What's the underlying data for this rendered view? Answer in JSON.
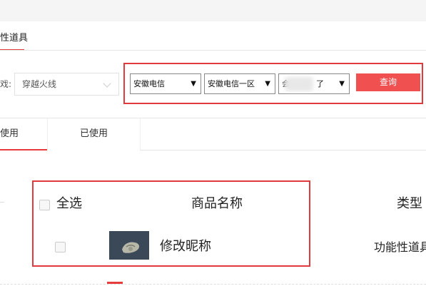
{
  "header": {
    "tab_title": "性道具"
  },
  "filters": {
    "game_label": "戏:",
    "game_value": "穿越火线",
    "telecom": "安徽电信",
    "server": "安徽电信一区",
    "role_prefix": "会",
    "role_suffix": "了",
    "query_button": "查询"
  },
  "status_tabs": {
    "unused": "使用",
    "used": "已使用"
  },
  "table": {
    "select_all": "全选",
    "col_name": "商品名称",
    "col_type": "类型"
  },
  "rows": [
    {
      "name": "修改昵称",
      "type": "功能性道具"
    }
  ],
  "colors": {
    "accent": "#e63c3c",
    "button": "#f05050",
    "highlight_box": "#e0393e"
  },
  "icons": [
    "chevron-down-icon",
    "dropdown-arrow-icon",
    "checkbox-icon"
  ]
}
